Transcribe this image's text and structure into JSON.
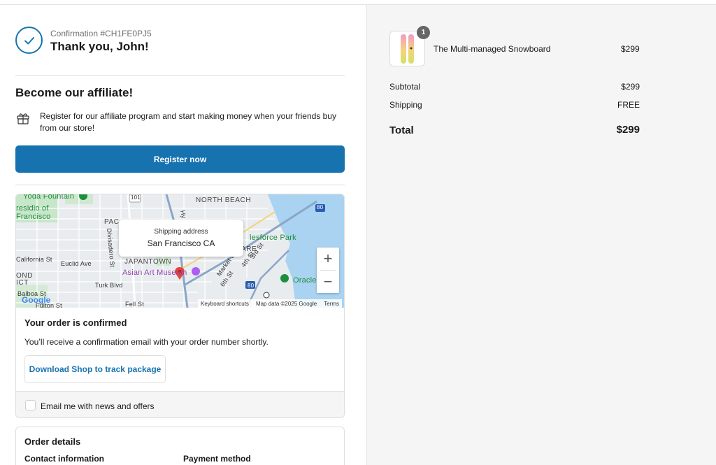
{
  "confirmation": {
    "number": "Confirmation #CH1FE0PJ5",
    "thanks": "Thank you, John!"
  },
  "affiliate": {
    "title": "Become our affiliate!",
    "text": "Register for our affiliate program and start making money when your friends buy from our store!",
    "button": "Register now",
    "icon": "gift-icon"
  },
  "map": {
    "tooltip_label": "Shipping address",
    "tooltip_value": "San Francisco CA",
    "labels": {
      "north_beach": "NORTH BEACH",
      "yoda": "Yoda Fountain",
      "presidio1": "residio of",
      "presidio2": "Francisco",
      "pac": "PAC",
      "divisadero": "Divisadero St",
      "japantown": "JAPANTOWN",
      "california": "California St",
      "euclid": "Euclid Ave",
      "ond": "OND",
      "ict": "ICT",
      "turk": "Turk Blvd",
      "balboa": "Balboa St",
      "fulton": "Fulton St",
      "fell": "Fell St",
      "asian_art": "Asian Art Museum",
      "salesforce": "lesforce Park",
      "oracle": "Oracle",
      "market": "Market St",
      "third": "3rd St",
      "fourth": "4th St",
      "sixth": "6th St",
      "are": "ARE",
      "hwy101": "101",
      "hwy80a": "80",
      "hwy80b": "80",
      "hyde": "Hy"
    },
    "zoom_in": "+",
    "zoom_out": "−",
    "google": "Google",
    "footer": {
      "shortcuts": "Keyboard shortcuts",
      "data": "Map data ©2025 Google",
      "terms": "Terms"
    }
  },
  "order_status": {
    "title": "Your order is confirmed",
    "text": "You’ll receive a confirmation email with your order number shortly.",
    "download_button": "Download Shop to track package",
    "newsletter_label": "Email me with news and offers",
    "newsletter_checked": false
  },
  "order_details": {
    "title": "Order details",
    "contact_heading": "Contact information",
    "payment_heading": "Payment method"
  },
  "summary": {
    "product_name": "The Multi-managed Snowboard",
    "product_price": "$299",
    "quantity": "1",
    "subtotal_label": "Subtotal",
    "subtotal_value": "$299",
    "shipping_label": "Shipping",
    "shipping_value": "FREE",
    "total_label": "Total",
    "total_value": "$299"
  },
  "colors": {
    "accent": "#1773b0",
    "sidebar_bg": "#f5f5f5",
    "water": "#a9d3f0"
  }
}
